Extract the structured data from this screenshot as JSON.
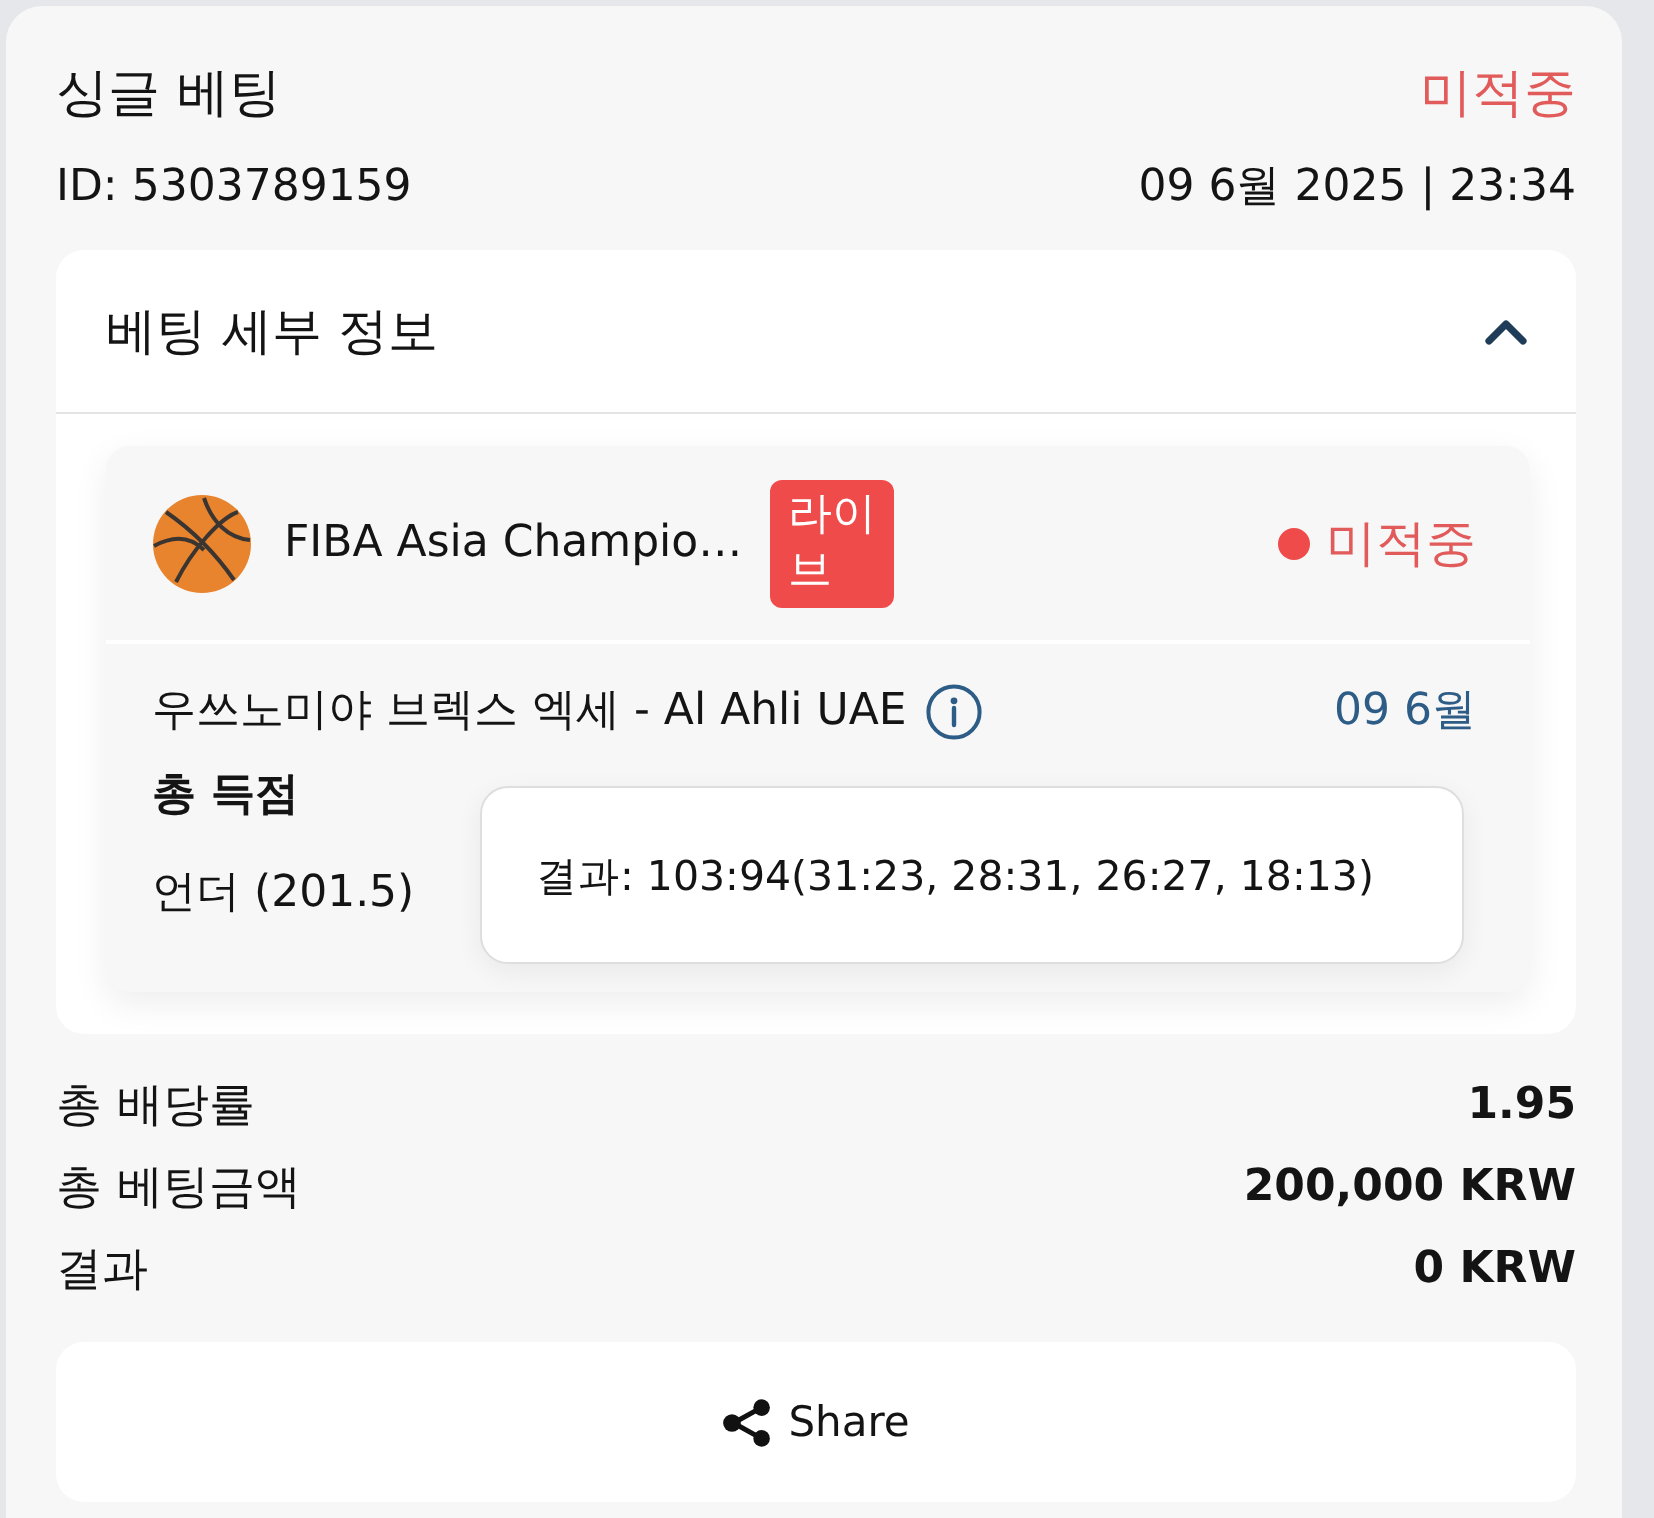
{
  "bet": {
    "title": "싱글 베팅",
    "status": "미적중",
    "id": "ID: 5303789159",
    "datetime": "09 6월 2025 | 23:34"
  },
  "details": {
    "title": "베팅 세부 정보",
    "expanded": true,
    "selection": {
      "kind": "basketball",
      "league": "FIBA Asia Champio…",
      "badge": "라이브",
      "status": "미적중",
      "match": "우쓰노미야 브렉스 엑세 - Al Ahli UAE",
      "date": "09 6월",
      "market": "총 득점",
      "pick": "언더 (201.5)"
    },
    "tooltip": {
      "text": "결과: 103:94(31:23, 28:31, 26:27, 18:13)"
    }
  },
  "summary": [
    {
      "label": "총 배당률",
      "value": "1.95"
    },
    {
      "label": "총 베팅금액",
      "value": "200,000 KRW"
    },
    {
      "label": "결과",
      "value": "0 KRW"
    }
  ],
  "share_button": {
    "label": "Share"
  }
}
